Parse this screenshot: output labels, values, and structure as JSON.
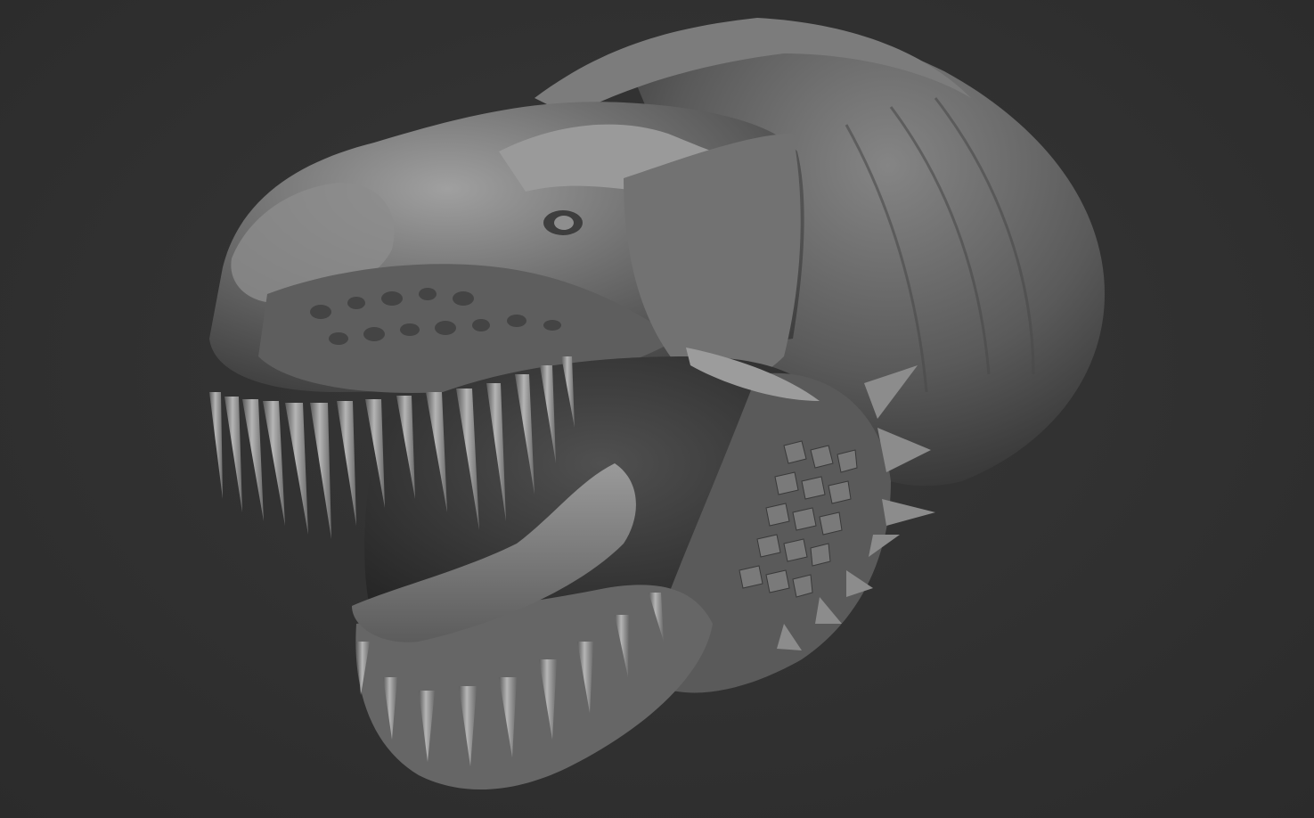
{
  "scene": {
    "background_color": "#303030",
    "material_light": "#a8a8a8",
    "material_mid": "#6e6e6e",
    "material_dark": "#2a2a2a",
    "subject_icon": "dinosaur-head-sculpt-icon"
  }
}
